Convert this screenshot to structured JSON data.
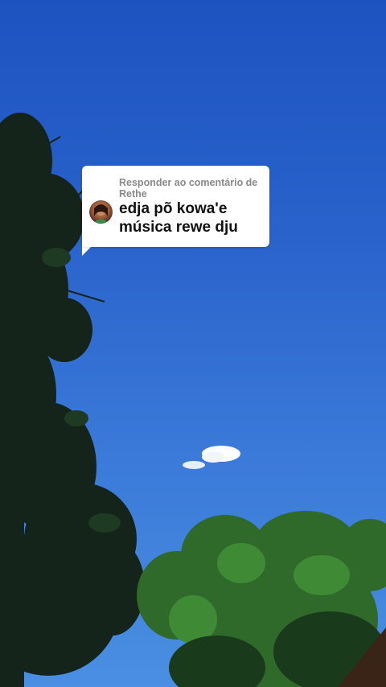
{
  "comment_reply": {
    "reply_to_label": "Responder ao comentário de Rethe",
    "comment_text": "edja põ kowa'e música rewe dju"
  },
  "colors": {
    "sky_top": "#1d53c0",
    "sky_bottom": "#4a8fe3",
    "foliage_dark": "#14241a",
    "foliage_green": "#2f6a2a",
    "card_background": "#ffffff",
    "label_gray": "#8a8a8a"
  },
  "icons": {
    "avatar": "user-avatar"
  }
}
